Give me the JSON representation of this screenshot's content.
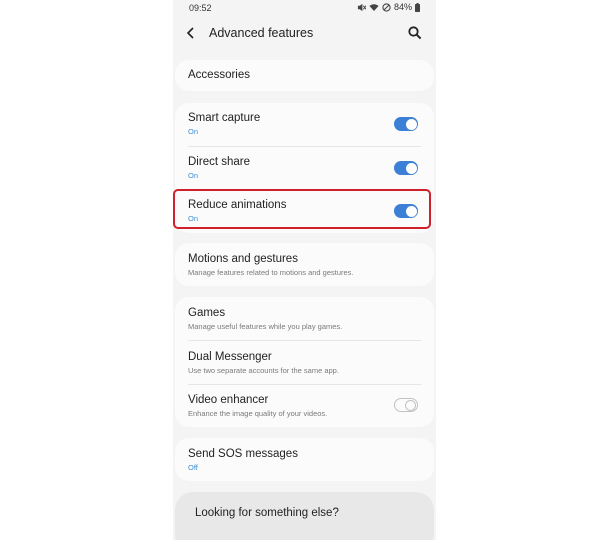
{
  "status_bar": {
    "time": "09:52",
    "battery": "84%",
    "icons": [
      "mute-icon",
      "wifi-icon",
      "block-icon",
      "battery-icon"
    ]
  },
  "header": {
    "title": "Advanced features",
    "back_icon": "chevron-left-icon",
    "search_icon": "search-icon"
  },
  "accessories": {
    "label": "Accessories"
  },
  "toggles_group": [
    {
      "label": "Smart capture",
      "status": "On",
      "enabled": true
    },
    {
      "label": "Direct share",
      "status": "On",
      "enabled": true
    },
    {
      "label": "Reduce animations",
      "status": "On",
      "enabled": true
    }
  ],
  "motions": {
    "label": "Motions and gestures",
    "description": "Manage features related to motions and gestures."
  },
  "games_group": [
    {
      "label": "Games",
      "description": "Manage useful features while you play games."
    },
    {
      "label": "Dual Messenger",
      "description": "Use two separate accounts for the same app."
    },
    {
      "label": "Video enhancer",
      "description": "Enhance the image quality of your videos.",
      "enabled": false
    }
  ],
  "sos": {
    "label": "Send SOS messages",
    "status": "Off"
  },
  "footer": {
    "label": "Looking for something else?"
  },
  "colors": {
    "accent": "#3b7fd6",
    "highlight": "#d0212a",
    "status_on": "#3e8ed0"
  }
}
